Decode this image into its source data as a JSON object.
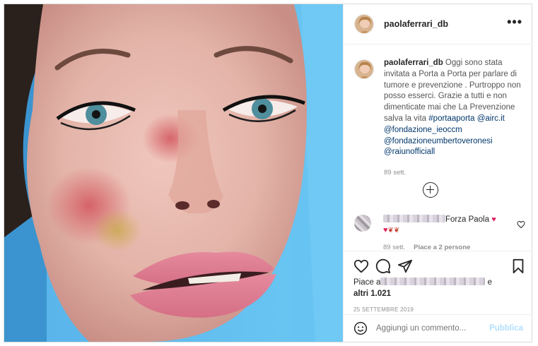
{
  "post": {
    "username": "paolaferrari_db",
    "more_label": "•••",
    "caption": {
      "username": "paolaferrari_db",
      "text": " Oggi sono stata invitata a Porta a Porta per parlare di tumore e prevenzione . Purtroppo non posso esserci. Grazie a tutti e non dimenticate mai che La Prevenzione salva la vita ",
      "tags": [
        "#portaaporta",
        "@airc.it",
        "@fondazione_ieoccm",
        "@fondazioneumbertoveronesi",
        "@raiunofficiall"
      ],
      "time": "89 sett."
    },
    "comment": {
      "text": "Forza Paola",
      "time": "89 sett.",
      "likes": "Piace a 2 persone"
    },
    "likes": {
      "prefix": "Piace a",
      "suffix": "e",
      "others": "altri 1.021"
    },
    "date": "25 SETTEMBRE 2019",
    "add_comment": {
      "placeholder": "Aggiungi un commento...",
      "publish": "Pubblica"
    }
  },
  "colors": {
    "link": "#00376b",
    "heart": "#e0245e",
    "publish_disabled": "#b2dffc",
    "photo_background": "#58b4ea"
  },
  "icons": [
    "more-icon",
    "add-circle-icon",
    "heart-icon",
    "comment-icon",
    "share-icon",
    "bookmark-icon",
    "emoji-icon"
  ]
}
